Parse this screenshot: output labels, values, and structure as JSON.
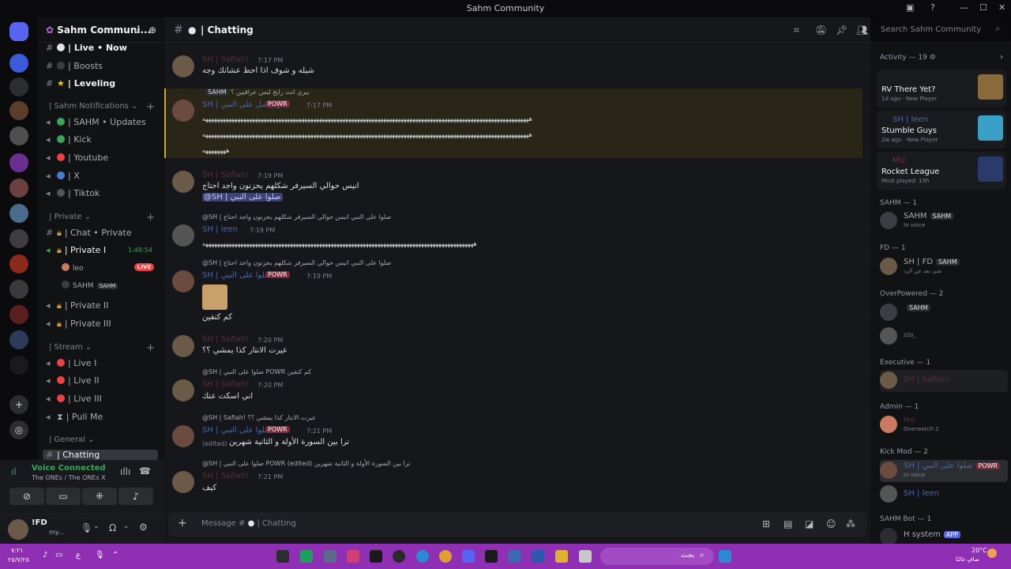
{
  "window": {
    "title": "Sahm Community"
  },
  "server": {
    "name": "Sahm Communi..."
  },
  "channels": [
    {
      "name": "| Live • Now",
      "y": 0
    },
    {
      "name": "| Boosts"
    },
    {
      "name": "| Leveling"
    },
    {
      "name": "| SAHM • Updates"
    },
    {
      "name": "| Kick"
    },
    {
      "name": "| Youtube"
    },
    {
      "name": "| X"
    },
    {
      "name": "| Tiktok"
    },
    {
      "name": "| Chat • Private"
    },
    {
      "name": "| Private I"
    },
    {
      "name": "| Private II"
    },
    {
      "name": "| Private III"
    },
    {
      "name": "| Live I"
    },
    {
      "name": "| Live II"
    },
    {
      "name": "| Live III"
    },
    {
      "name": "| Pull Me"
    },
    {
      "name": "| Chatting"
    }
  ],
  "categories": {
    "notifications": "| Sahm Notifications",
    "private": "| Private",
    "stream": "| Stream",
    "general": "| General"
  },
  "voice_users": {
    "timer": "1:48:54",
    "user1": "leo",
    "live": "LIVE",
    "user2": "SAHM",
    "user2_tag": "SAHM"
  },
  "voice_panel": {
    "status": "Voice Connected",
    "channel": "The ONEs / The ONEs X"
  },
  "user_panel": {
    "name": "!FD",
    "status": "my..."
  },
  "channel_header": {
    "name": "| Chatting",
    "search_placeholder": "Search Sahm Community"
  },
  "messages": [
    {
      "user": "SH | Safiah!",
      "time": "7:17 PM",
      "text": "شيله و شوف اذا احط عشانك وجه"
    },
    {
      "reply": "بيري انت رايح لبس عراقيين ؟",
      "user": "SH | اللهم صل على النبي",
      "badge": "POWR",
      "time": "7:17 PM",
      "text": "ههههههههههههههههههههههههههههههههههههههههههههههههههههههههههههههههههههههههههههههههههههههههههههههههههههههههههههههههه",
      "text2": "ههههههههه"
    },
    {
      "user": "SH | Safiah!",
      "time": "7:19 PM",
      "text": "انيس حوالي السيرفر شكلهم يحزنون واجد احتاج",
      "mention": "@SH | صلوا على النبي"
    },
    {
      "reply": "@SH | صلوا على النبي انيس حوالي السيرفر شكلهم يحزنون واجد احتاج",
      "user": "SH | leen",
      "time": "7:19 PM",
      "text": "هههههههههههههههههههههههههههههههههههههههههههههههههههههههههههههههههههههههههههههههههههههههههههههه"
    },
    {
      "reply": "@SH | صلوا على النبي انيس حوالي السيرفر شكلهم يحزنون واجد احتاج",
      "user": "SH | صلوا على النبي",
      "badge": "POWR",
      "time": "7:19 PM",
      "text": "كم كنفين"
    },
    {
      "user": "SH | Safiah!",
      "time": "7:20 PM",
      "text": "عيرت الانتار كذا يمشي ؟؟"
    },
    {
      "reply": "@SH | صلوا على النبي POWR كم كنفين",
      "user": "SH | Safiah!",
      "time": "7:20 PM",
      "text": "اني اسكت عنك"
    },
    {
      "reply": "@SH | Safiah! عيرت الانتار كذا يمشي ؟؟",
      "user": "SH | صلوا على النبي",
      "badge": "POWR",
      "time": "7:21 PM",
      "text": "ترا بين السورة الأولة و الثانية شهرين",
      "edited": "(edited)"
    },
    {
      "reply": "@SH | صلوا على النبي POWR (edited) ترا بين السورة الأولة و الثانية شهرين",
      "user": "SH | Safiah!",
      "time": "7:21 PM",
      "text": "كيف"
    }
  ],
  "composer": {
    "placeholder": "Message #",
    "channel": "| Chatting"
  },
  "members": {
    "activity_header": "Activity — 19",
    "cards": [
      {
        "title": "RV There Yet?",
        "sub": "1d ago",
        "badge": "New Player"
      },
      {
        "user": "SH | leen",
        "title": "Stumble Guys",
        "sub": "2w ago",
        "badge": "New Player"
      },
      {
        "user": "MU",
        "title": "Rocket League",
        "sub": "Most played: 19h"
      }
    ],
    "groups": [
      {
        "header": "SAHM — 1",
        "name": "SAHM",
        "tag": "SAHM",
        "sub": "In voice"
      },
      {
        "header": "FD — 1",
        "name": "SH | FD",
        "tag": "SAHM",
        "sub": "شي بعد عن الرد"
      },
      {
        "header": "OverPowered — 2",
        "name": "",
        "tag": "SAHM",
        "sub": "z2o_"
      },
      {
        "header": "Executive — 1",
        "name": "SH | Safiah!"
      },
      {
        "header": "Admin — 1",
        "name": "leo",
        "sub": "Overwatch 2"
      },
      {
        "header": "Kick Mod — 2",
        "name": "SH | صلوا على النبي",
        "badge": "POWR",
        "sub": "In voice",
        "name2": "SH | leen"
      },
      {
        "header": "SAHM Bot — 1",
        "name": "H system",
        "badge": "APP"
      }
    ]
  },
  "taskbar": {
    "time": "٧:٢١",
    "date": "٢٥/٧/٢٥",
    "search": "بحث",
    "weather": "20°C",
    "weather_sub": "صافٍ غالبًا"
  },
  "colors": {
    "accent": "#5865f2",
    "mention": "#3c4270",
    "taskbar": "#8f2fb3",
    "highlight_border": "#c9a440"
  }
}
